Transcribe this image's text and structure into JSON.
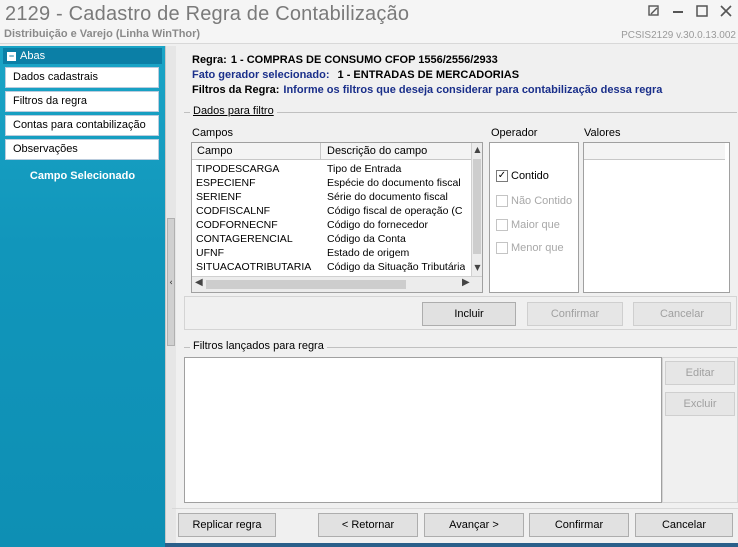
{
  "window": {
    "title": "2129 - Cadastro de Regra de Contabilização",
    "subtitle": "Distribuição e Varejo (Linha WinThor)",
    "version": "PCSIS2129  v.30.0.13.002",
    "icons": [
      "restore-icon",
      "minimize-icon",
      "maximize-icon",
      "close-icon"
    ]
  },
  "sidebar": {
    "header": "Abas",
    "items": [
      {
        "label": "Dados cadastrais"
      },
      {
        "label": "Filtros da regra"
      },
      {
        "label": "Contas para contabilização"
      },
      {
        "label": "Observações"
      }
    ],
    "selected_section": "Campo Selecionado",
    "splitter_glyph": "‹"
  },
  "header": {
    "regra_label": "Regra:",
    "regra_value": "1 - COMPRAS DE CONSUMO CFOP 1556/2556/2933",
    "fato_label": "Fato gerador selecionado:",
    "fato_value": "1 - ENTRADAS DE MERCADORIAS",
    "filtros_label": "Filtros da Regra:",
    "filtros_value": "Informe os filtros que deseja considerar para contabilização dessa regra"
  },
  "filter_group": {
    "title": "Dados para filtro",
    "campos_label": "Campos",
    "operador_label": "Operador",
    "valores_label": "Valores",
    "columns": [
      "Campo",
      "Descrição do campo"
    ],
    "rows": [
      {
        "campo": "TIPODESCARGA",
        "descricao": "Tipo de Entrada"
      },
      {
        "campo": "ESPECIENF",
        "descricao": "Espécie do documento fiscal"
      },
      {
        "campo": "SERIENF",
        "descricao": "Série do documento fiscal"
      },
      {
        "campo": "CODFISCALNF",
        "descricao": "Código fiscal de operação (C"
      },
      {
        "campo": "CODFORNECNF",
        "descricao": "Código do fornecedor"
      },
      {
        "campo": "CONTAGERENCIAL",
        "descricao": "Código da Conta"
      },
      {
        "campo": "UFNF",
        "descricao": "Estado de origem"
      },
      {
        "campo": "SITUACAOTRIBUTARIA",
        "descricao": "Código da Situação Tributária"
      }
    ],
    "operators": [
      {
        "label": "Contido",
        "checked": true,
        "enabled": true
      },
      {
        "label": "Não Contido",
        "checked": false,
        "enabled": false
      },
      {
        "label": "Maior que",
        "checked": false,
        "enabled": false
      },
      {
        "label": "Menor que",
        "checked": false,
        "enabled": false
      }
    ],
    "buttons": {
      "incluir": "Incluir",
      "confirmar": "Confirmar",
      "cancelar": "Cancelar"
    }
  },
  "lancados": {
    "title": "Filtros lançados para regra",
    "buttons": {
      "editar": "Editar",
      "excluir": "Excluir"
    }
  },
  "footer": {
    "replicar": "Replicar regra",
    "retornar": "< Retornar",
    "avancar": "Avançar >",
    "confirmar": "Confirmar",
    "cancelar": "Cancelar"
  },
  "colors": {
    "sidebar_bg": "#1196bb",
    "header_blue_text": "#1a2f8a",
    "bottom_strip": "#2a5f8a"
  }
}
